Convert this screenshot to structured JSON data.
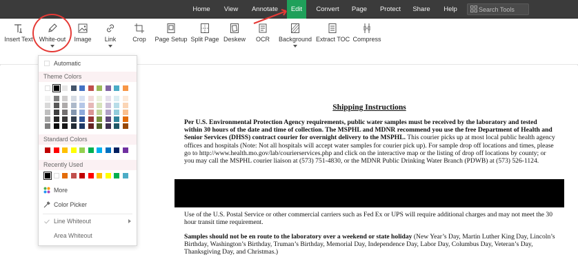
{
  "menubar": {
    "items": [
      {
        "label": "Home"
      },
      {
        "label": "View"
      },
      {
        "label": "Annotate"
      },
      {
        "label": "Edit"
      },
      {
        "label": "Convert"
      },
      {
        "label": "Page"
      },
      {
        "label": "Protect"
      },
      {
        "label": "Share"
      },
      {
        "label": "Help"
      }
    ],
    "active": "Edit",
    "active_color": "#1fa05a",
    "search_placeholder": "Search Tools"
  },
  "toolbar": {
    "tools": [
      {
        "label": "Insert Text",
        "icon": "insert-text-icon"
      },
      {
        "label": "White-out",
        "icon": "white-out-pen-icon"
      },
      {
        "label": "Image",
        "icon": "image-icon"
      },
      {
        "label": "Link",
        "icon": "link-icon"
      },
      {
        "label": "Crop",
        "icon": "crop-icon"
      },
      {
        "label": "Page Setup",
        "icon": "page-setup-icon"
      },
      {
        "label": "Split Page",
        "icon": "split-page-icon"
      },
      {
        "label": "Deskew",
        "icon": "deskew-icon"
      },
      {
        "label": "OCR",
        "icon": "ocr-icon"
      },
      {
        "label": "Background",
        "icon": "background-icon"
      },
      {
        "label": "Extract TOC",
        "icon": "extract-toc-icon"
      },
      {
        "label": "Compress",
        "icon": "compress-icon"
      }
    ]
  },
  "annotation": {
    "highlight_color": "#e53935"
  },
  "dropdown": {
    "automatic_label": "Automatic",
    "theme_colors_label": "Theme Colors",
    "standard_colors_label": "Standard Colors",
    "recently_used_label": "Recently Used",
    "more_label": "More",
    "color_picker_label": "Color Picker",
    "line_whiteout_label": "Line Whiteout",
    "area_whiteout_label": "Area Whiteout",
    "theme_top_row": [
      "#ffffff",
      "#000000",
      "#e7e6e6",
      "#44546a",
      "#4472c4",
      "#c0504d",
      "#9bbb59",
      "#8064a2",
      "#4bacc6",
      "#f79646"
    ],
    "theme_shade_columns": [
      [
        "#f2f2f2",
        "#d9d9d9",
        "#bfbfbf",
        "#a6a6a6",
        "#808080"
      ],
      [
        "#7f7f7f",
        "#595959",
        "#3f3f3f",
        "#262626",
        "#0d0d0d"
      ],
      [
        "#d0cece",
        "#aeabab",
        "#757171",
        "#3a3838",
        "#171616"
      ],
      [
        "#d6dce4",
        "#adb9ca",
        "#8497b0",
        "#333f4f",
        "#222a35"
      ],
      [
        "#d9e2f3",
        "#b4c6e7",
        "#8eaadb",
        "#2f5496",
        "#1f3864"
      ],
      [
        "#f2dcdb",
        "#e6b8b7",
        "#da9694",
        "#963634",
        "#632523"
      ],
      [
        "#ebf1dd",
        "#d7e3bc",
        "#c3d69b",
        "#76923c",
        "#4f6128"
      ],
      [
        "#e5e0ec",
        "#ccc1d9",
        "#b2a2c7",
        "#5f497a",
        "#3f3151"
      ],
      [
        "#dbeef3",
        "#b7dde8",
        "#92cddc",
        "#31859b",
        "#205867"
      ],
      [
        "#fdeada",
        "#fbd5b5",
        "#fac08f",
        "#e36c09",
        "#974806"
      ]
    ],
    "standard_colors": [
      "#c00000",
      "#ff0000",
      "#ffc000",
      "#ffff00",
      "#92d050",
      "#00b050",
      "#00b0f0",
      "#0070c0",
      "#002060",
      "#7030a0"
    ],
    "recent_colors": [
      "#000000",
      "#ffffff",
      "#e36c09",
      "#c0504d",
      "#c00000",
      "#ff0000",
      "#ffc000",
      "#ffff00",
      "#00b050",
      "#4bacc6"
    ]
  },
  "document": {
    "title": "Shipping Instructions",
    "para1_bold": "Per U.S. Environmental Protection Agency requirements, public water samples must be received by the laboratory and tested within 30 hours of the date and time of collection. The MSPHL and MDNR recommend you use the free Department of Health and Senior Services (DHSS) contract courier for overnight delivery to the MSPHL.",
    "para1_rest": " This courier picks up at most local public health agency offices and hospitals (Note: Not all hospitals will accept water samples for courier pick up). For sample drop off locations and times, please go to http://www.health.mo.gov/lab/courierservices.php and click on the interactive map or the listing of drop off locations by county; or you may call the MSPHL courier liaison at (573) 751-4830, or the MDNR Public Drinking Water Branch (PDWB) at (573) 526-1124.",
    "para2": "Use of the U.S. Postal Service or other commercial carriers such as Fed Ex or UPS will require additional charges and may not meet the 30 hour transit time requirement.",
    "para3_bold": "Samples should not be en route to the laboratory over a weekend or state holiday",
    "para3_rest": " (New Year’s Day, Martin Luther King Day, Lincoln’s Birthday, Washington’s Birthday, Truman’s Birthday, Memorial Day, Independence Day, Labor Day, Columbus Day, Veteran’s Day, Thanksgiving Day, and Christmas.)"
  }
}
